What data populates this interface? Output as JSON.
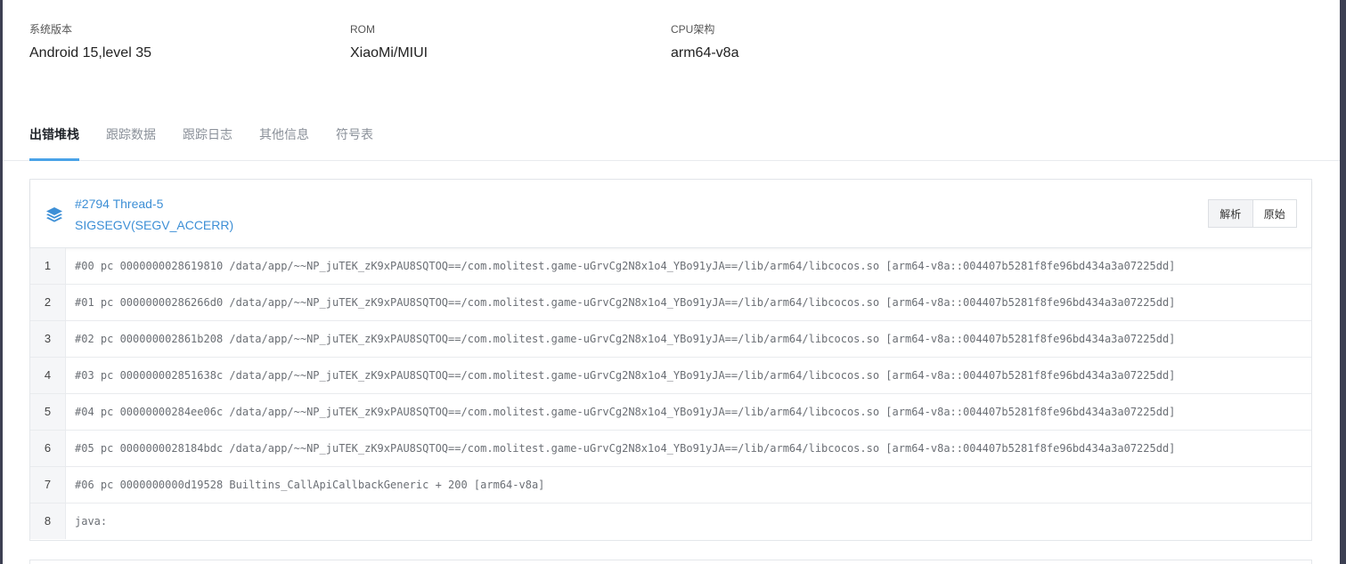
{
  "device_info": [
    {
      "label": "系统版本",
      "value": "Android 15,level 35"
    },
    {
      "label": "ROM",
      "value": "XiaoMi/MIUI"
    },
    {
      "label": "CPU架构",
      "value": "arm64-v8a"
    }
  ],
  "tabs": [
    "出错堆栈",
    "跟踪数据",
    "跟踪日志",
    "其他信息",
    "符号表"
  ],
  "thread": {
    "title": "#2794 Thread-5",
    "signal": "SIGSEGV(SEGV_ACCERR)"
  },
  "view_buttons": {
    "parsed": "解析",
    "raw": "原始"
  },
  "icons": {
    "thread_icon": "layers-icon"
  },
  "colors": {
    "accent": "#4aa3e8",
    "link": "#3d8fd6"
  },
  "stack": [
    {
      "line": "1",
      "text": "#00 pc 0000000028619810 /data/app/~~NP_juTEK_zK9xPAU8SQTOQ==/com.molitest.game-uGrvCg2N8x1o4_YBo91yJA==/lib/arm64/libcocos.so [arm64-v8a::004407b5281f8fe96bd434a3a07225dd]"
    },
    {
      "line": "2",
      "text": "#01 pc 00000000286266d0 /data/app/~~NP_juTEK_zK9xPAU8SQTOQ==/com.molitest.game-uGrvCg2N8x1o4_YBo91yJA==/lib/arm64/libcocos.so [arm64-v8a::004407b5281f8fe96bd434a3a07225dd]"
    },
    {
      "line": "3",
      "text": "#02 pc 000000002861b208 /data/app/~~NP_juTEK_zK9xPAU8SQTOQ==/com.molitest.game-uGrvCg2N8x1o4_YBo91yJA==/lib/arm64/libcocos.so [arm64-v8a::004407b5281f8fe96bd434a3a07225dd]"
    },
    {
      "line": "4",
      "text": "#03 pc 000000002851638c /data/app/~~NP_juTEK_zK9xPAU8SQTOQ==/com.molitest.game-uGrvCg2N8x1o4_YBo91yJA==/lib/arm64/libcocos.so [arm64-v8a::004407b5281f8fe96bd434a3a07225dd]"
    },
    {
      "line": "5",
      "text": "#04 pc 00000000284ee06c /data/app/~~NP_juTEK_zK9xPAU8SQTOQ==/com.molitest.game-uGrvCg2N8x1o4_YBo91yJA==/lib/arm64/libcocos.so [arm64-v8a::004407b5281f8fe96bd434a3a07225dd]"
    },
    {
      "line": "6",
      "text": "#05 pc 0000000028184bdc /data/app/~~NP_juTEK_zK9xPAU8SQTOQ==/com.molitest.game-uGrvCg2N8x1o4_YBo91yJA==/lib/arm64/libcocos.so [arm64-v8a::004407b5281f8fe96bd434a3a07225dd]"
    },
    {
      "line": "7",
      "text": "#06 pc 0000000000d19528 Builtins_CallApiCallbackGeneric + 200 [arm64-v8a]"
    },
    {
      "line": "8",
      "text": "java:"
    }
  ]
}
